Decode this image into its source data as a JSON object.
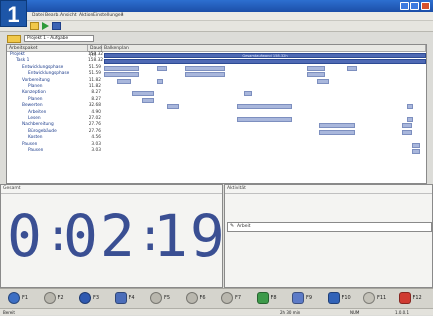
{
  "badge": "1",
  "menu": [
    "Datei",
    "Bearb.",
    "Ansicht",
    "Aktion",
    "Einstellungen",
    "?"
  ],
  "path_label": "Projekt 1 - Aufgabe",
  "tree": {
    "col_name": "Arbeitspaket",
    "col_duration": "Dauer [h]",
    "col_gantt": "Balkenplan",
    "rows": [
      {
        "name": "Projekt",
        "value": "158.32",
        "indent": 0
      },
      {
        "name": "Task 1",
        "value": "158.32",
        "indent": 1
      },
      {
        "name": "Entwicklungsphase",
        "value": "51.59",
        "indent": 2
      },
      {
        "name": "Entwicklungsphase",
        "value": "51.59",
        "indent": 3
      },
      {
        "name": "Vorbereitung",
        "value": "11.82",
        "indent": 2
      },
      {
        "name": "Planen",
        "value": "11.82",
        "indent": 3
      },
      {
        "name": "Konzeption",
        "value": "8.27",
        "indent": 2
      },
      {
        "name": "Planen",
        "value": "8.27",
        "indent": 3
      },
      {
        "name": "Bewerten",
        "value": "32.68",
        "indent": 2
      },
      {
        "name": "Arbeiten",
        "value": "4.90",
        "indent": 3
      },
      {
        "name": "Lesen",
        "value": "27.02",
        "indent": 3
      },
      {
        "name": "Nachbereitung",
        "value": "27.76",
        "indent": 2
      },
      {
        "name": "Bürogebäude",
        "value": "27.76",
        "indent": 3
      },
      {
        "name": "Kosten",
        "value": "4.56",
        "indent": 3
      },
      {
        "name": "Pausen",
        "value": "3.03",
        "indent": 2
      },
      {
        "name": "Pausen",
        "value": "3.03",
        "indent": 3
      }
    ],
    "summary_bar_label": "Gesamtaufwand 158.32h"
  },
  "timer": {
    "title": "Gesamt",
    "hours": "0",
    "minutes": "02",
    "seconds": "19"
  },
  "activity": {
    "title": "Aktivität",
    "entry": "Arbeit"
  },
  "fkeys": [
    {
      "label": "F1",
      "icon": "help-icon",
      "color": "#3d6fc4"
    },
    {
      "label": "F2",
      "icon": "blank-icon",
      "color": "#b9b7ae"
    },
    {
      "label": "F3",
      "icon": "play-icon",
      "color": "#2f59b0"
    },
    {
      "label": "F4",
      "icon": "calendar-icon",
      "color": "#4b6db9"
    },
    {
      "label": "F5",
      "icon": "blank-icon",
      "color": "#b9b7ae"
    },
    {
      "label": "F6",
      "icon": "blank-icon",
      "color": "#b9b7ae"
    },
    {
      "label": "F7",
      "icon": "blank-icon",
      "color": "#b9b7ae"
    },
    {
      "label": "F8",
      "icon": "edit-icon",
      "color": "#3d9a4a"
    },
    {
      "label": "F9",
      "icon": "tools-icon",
      "color": "#5d7bc7"
    },
    {
      "label": "F10",
      "icon": "clock-icon",
      "color": "#3263b8"
    },
    {
      "label": "F11",
      "icon": "blank-icon",
      "color": "#c4c2b9"
    },
    {
      "label": "F12",
      "icon": "stop-icon",
      "color": "#d03b32"
    }
  ],
  "status": {
    "left": "Bereit",
    "mid": "2h 30 min",
    "right1": "NUM",
    "right2": "1.0.0.1"
  }
}
